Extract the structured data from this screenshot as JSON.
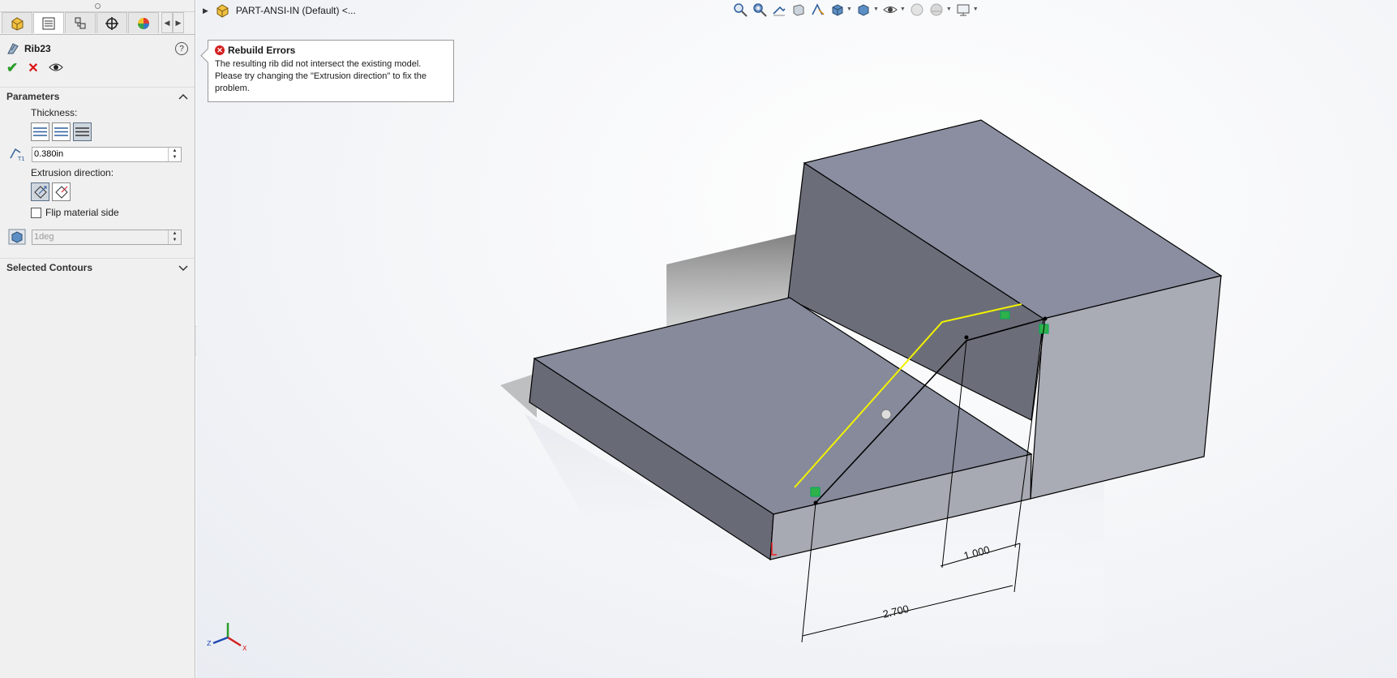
{
  "panel": {
    "feature_title": "Rib23",
    "help_glyph": "?",
    "parameters_label": "Parameters",
    "thickness_label": "Thickness:",
    "thickness_value": "0.380in",
    "extrusion_label": "Extrusion direction:",
    "flip_label": "Flip material side",
    "draft_value": "1deg",
    "selected_contours_label": "Selected Contours"
  },
  "document": {
    "title": "PART-ANSI-IN (Default) <..."
  },
  "error": {
    "title": "Rebuild Errors",
    "message": "The resulting rib did not intersect the existing model. Please try changing the \"Extrusion direction\" to fix the problem."
  },
  "dimensions": {
    "d1": "1.000",
    "d2": "2.700"
  },
  "triad": {
    "x": "X",
    "y": "Y",
    "z": "Z"
  },
  "colors": {
    "accent_ok": "#2a9d2a",
    "accent_cancel": "#d11111",
    "sketch_yellow": "#f2f200",
    "model_top": "#8a8ea0",
    "model_side": "#6a6d78",
    "model_front": "#a8aab4"
  }
}
